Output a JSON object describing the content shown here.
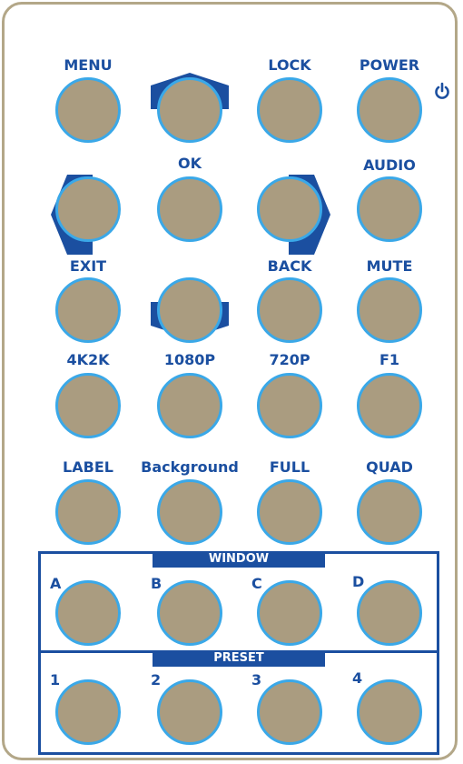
{
  "buttons": {
    "menu": "MENU",
    "ok": "OK",
    "lock": "LOCK",
    "power": "POWER",
    "audio": "AUDIO",
    "exit": "EXIT",
    "back": "BACK",
    "mute": "MUTE",
    "res_4k2k": "4K2K",
    "res_1080p": "1080P",
    "res_720p": "720P",
    "f1": "F1",
    "label": "LABEL",
    "background": "Background",
    "full": "FULL",
    "quad": "QUAD"
  },
  "window_section": {
    "title": "WINDOW",
    "a": "A",
    "b": "B",
    "c": "C",
    "d": "D"
  },
  "preset_section": {
    "title": "PRESET",
    "p1": "1",
    "p2": "2",
    "p3": "3",
    "p4": "4"
  },
  "icons": {
    "power": "power-icon",
    "up": "up-arrow-icon",
    "down": "down-arrow-icon",
    "left": "left-arrow-icon",
    "right": "right-arrow-icon"
  },
  "colors": {
    "button_fill": "#aa9c80",
    "button_ring": "#3aa8e8",
    "label_text": "#1b4fa0",
    "panel_border": "#b3a788",
    "nav_shape": "#1b4fa0"
  }
}
